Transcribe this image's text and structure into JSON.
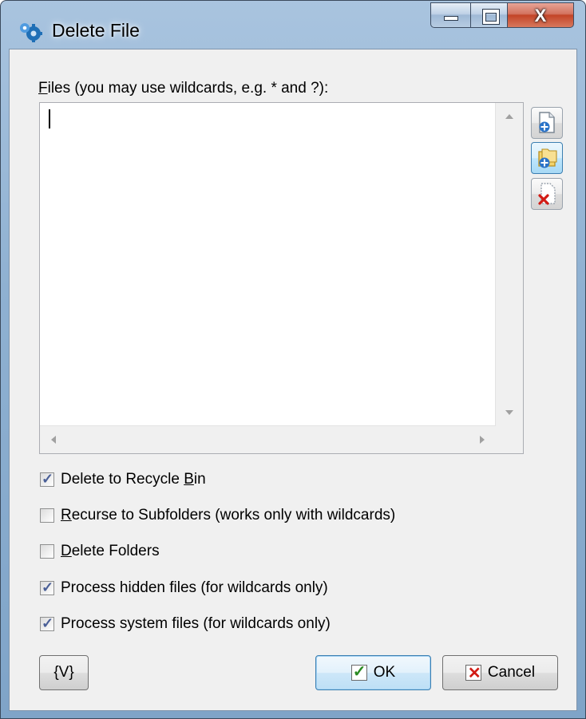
{
  "window": {
    "title": "Delete File",
    "caption_buttons": {
      "minimize_icon": "minimize-icon",
      "maximize_icon": "maximize-icon",
      "close_glyph": "X"
    },
    "frame_color": "#8fb1d2",
    "close_color": "#c34427"
  },
  "files": {
    "label_hotkey": "F",
    "label_rest": "iles (you may use wildcards, e.g. * and ?):",
    "value": "",
    "side_buttons": [
      {
        "name": "add-file-button",
        "icon": "add-file-icon"
      },
      {
        "name": "add-folder-button",
        "icon": "add-folder-icon"
      },
      {
        "name": "remove-item-button",
        "icon": "remove-item-icon"
      }
    ]
  },
  "options": [
    {
      "pre": "Delete to Recycle ",
      "hotkey": "B",
      "post": "in",
      "checked": true
    },
    {
      "pre": "",
      "hotkey": "R",
      "post": "ecurse to Subfolders (works only with wildcards)",
      "checked": false
    },
    {
      "pre": "",
      "hotkey": "D",
      "post": "elete Folders",
      "checked": false
    },
    {
      "pre": "Process hidden files (for wildcards only)",
      "hotkey": "",
      "post": "",
      "checked": true
    },
    {
      "pre": "Process system files (for wildcards only)",
      "hotkey": "",
      "post": "",
      "checked": true
    }
  ],
  "buttons": {
    "variables": "{V}",
    "ok": "OK",
    "cancel": "Cancel"
  }
}
